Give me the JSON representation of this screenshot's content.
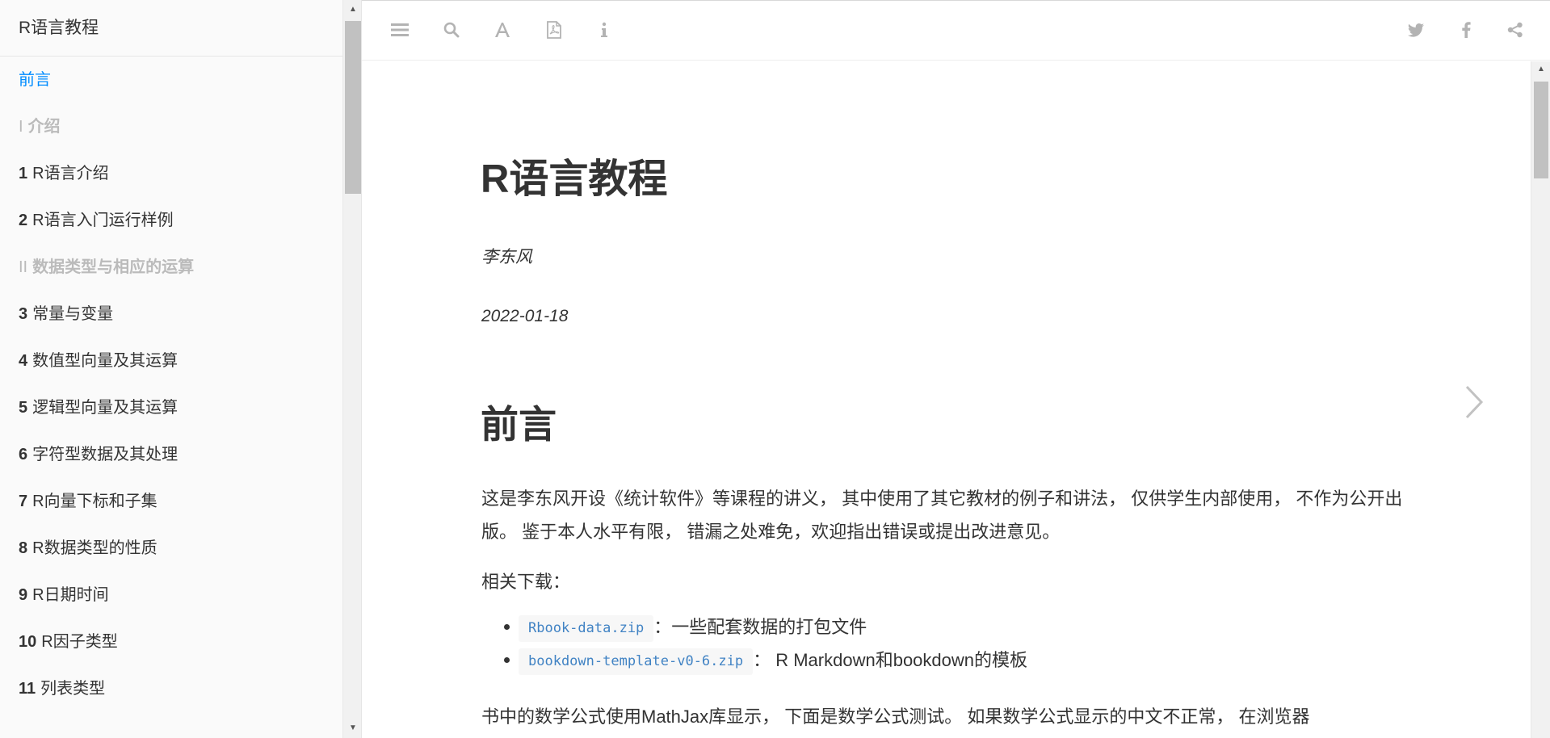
{
  "sidebar": {
    "title": "R语言教程",
    "items": [
      {
        "num": "",
        "label": "前言",
        "active": true
      },
      {
        "num": "I",
        "label": "介绍",
        "part": true
      },
      {
        "num": "1",
        "label": "R语言介绍"
      },
      {
        "num": "2",
        "label": "R语言入门运行样例"
      },
      {
        "num": "II",
        "label": "数据类型与相应的运算",
        "part": true
      },
      {
        "num": "3",
        "label": "常量与变量"
      },
      {
        "num": "4",
        "label": "数值型向量及其运算"
      },
      {
        "num": "5",
        "label": "逻辑型向量及其运算"
      },
      {
        "num": "6",
        "label": "字符型数据及其处理"
      },
      {
        "num": "7",
        "label": "R向量下标和子集"
      },
      {
        "num": "8",
        "label": "R数据类型的性质"
      },
      {
        "num": "9",
        "label": "R日期时间"
      },
      {
        "num": "10",
        "label": "R因子类型"
      },
      {
        "num": "11",
        "label": "列表类型"
      }
    ],
    "scroll_up": "▲",
    "scroll_down": "▼"
  },
  "toolbar": {
    "left_icons": [
      "menu-icon",
      "search-icon",
      "font-icon",
      "pdf-icon",
      "info-icon"
    ],
    "right_icons": [
      "twitter-icon",
      "facebook-icon",
      "share-icon"
    ]
  },
  "content": {
    "book_title": "R语言教程",
    "author": "李东风",
    "date": "2022-01-18",
    "section_title": "前言",
    "intro_paragraph": "这是李东风开设《统计软件》等课程的讲义， 其中使用了其它教材的例子和讲法， 仅供学生内部使用， 不作为公开出版。 鉴于本人水平有限， 错漏之处难免，欢迎指出错误或提出改进意见。",
    "downloads_label": "相关下载：",
    "downloads": [
      {
        "link": "Rbook-data.zip",
        "desc": "：一些配套数据的打包文件"
      },
      {
        "link": "bookdown-template-v0-6.zip",
        "desc": "： R Markdown和bookdown的模板"
      }
    ],
    "math_paragraph": "书中的数学公式使用MathJax库显示， 下面是数学公式测试。 如果数学公式显示的中文不正常， 在浏览器"
  },
  "navigation": {
    "next_icon": "chevron-right-icon"
  },
  "colors": {
    "active": "#008cff",
    "part": "#bbbbbb",
    "icon": "#b3b3b3",
    "code_link": "#4183c4",
    "text": "#333333"
  }
}
